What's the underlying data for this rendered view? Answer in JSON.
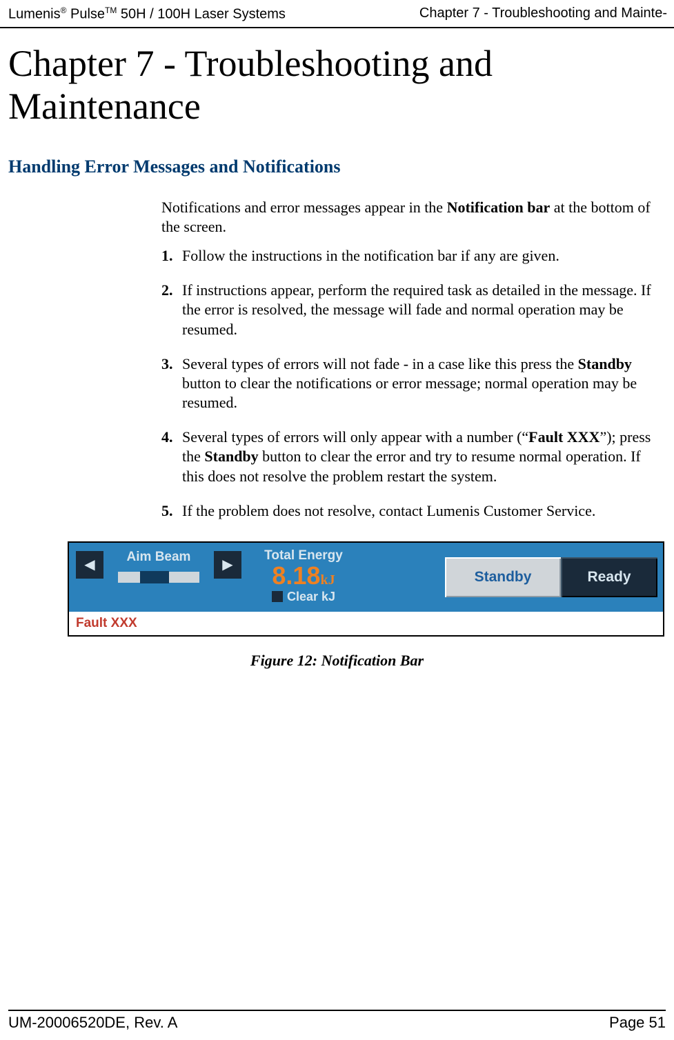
{
  "header": {
    "left_prefix": "Lumenis",
    "left_sup1": "®",
    "left_mid": " Pulse",
    "left_sup2": "TM",
    "left_suffix": " 50H / 100H Laser Systems",
    "right": "Chapter 7 - Troubleshooting and Mainte-"
  },
  "chapter_title": "Chapter 7 - Troubleshooting and Maintenance",
  "section_title": "Handling Error Messages and Notifications",
  "intro": {
    "pre": "Notifications and error messages appear in the ",
    "bold": "Notification bar",
    "post": " at the bottom of the screen."
  },
  "steps": [
    {
      "num": "1.",
      "parts": [
        {
          "t": "Follow the instructions in the notification bar if any are given."
        }
      ]
    },
    {
      "num": "2.",
      "parts": [
        {
          "t": "If instructions appear, perform the required task as detailed in the message. If the error is resolved, the message will fade and normal operation may be resumed."
        }
      ]
    },
    {
      "num": "3.",
      "parts": [
        {
          "t": "Several types of errors will not fade - in a case like this press the "
        },
        {
          "b": "Standby"
        },
        {
          "t": " button to clear the notifications or error message; normal operation may be resumed."
        }
      ]
    },
    {
      "num": "4.",
      "parts": [
        {
          "t": "Several types of errors will only appear with a number (“"
        },
        {
          "b": "Fault XXX"
        },
        {
          "t": "”); press the "
        },
        {
          "b": "Standby"
        },
        {
          "t": " button to clear the error and try to resume normal operation. If this does not resolve the problem restart the system."
        }
      ]
    },
    {
      "num": "5.",
      "parts": [
        {
          "t": "If the problem does not resolve, contact Lumenis Customer Service."
        }
      ]
    }
  ],
  "notif_bar": {
    "aim_label": "Aim Beam",
    "energy_label": "Total Energy",
    "energy_value": "8.18",
    "energy_unit": "kJ",
    "clear_label": "Clear kJ",
    "standby": "Standby",
    "ready": "Ready",
    "fault": "Fault XXX"
  },
  "figure_caption": "Figure 12: Notification Bar",
  "footer": {
    "left": "UM-20006520DE, Rev. A",
    "right": "Page 51"
  }
}
